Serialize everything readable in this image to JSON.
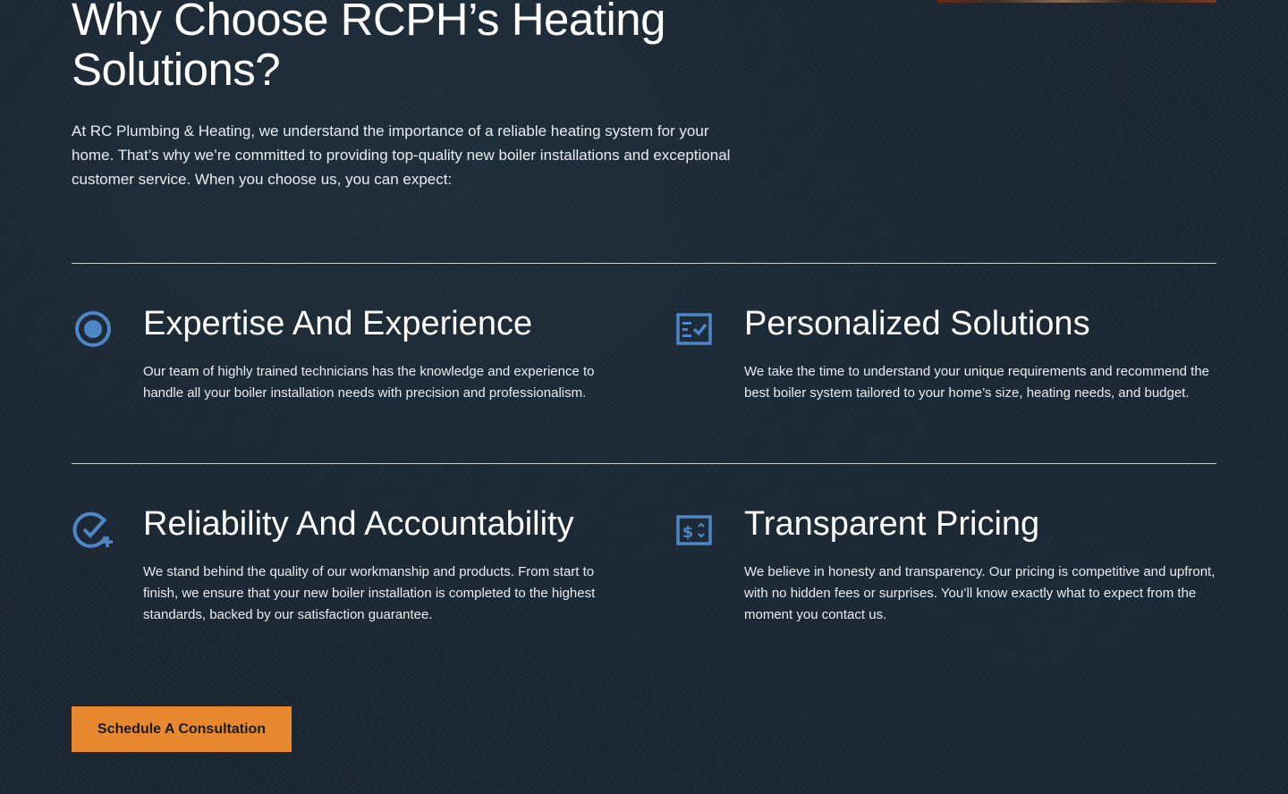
{
  "section": {
    "heading": "Why Choose RCPH’s Heating Solutions?",
    "intro": "At RC Plumbing & Heating, we understand the importance of a reliable heating system for your home. That’s why we’re committed to providing top-quality new boiler installations and exceptional customer service. When you choose us, you can expect:"
  },
  "features": [
    {
      "icon": "target-icon",
      "title": "Expertise And Experience",
      "description": "Our team of highly trained technicians has the knowledge and experience to handle all your boiler installation needs with precision and professionalism."
    },
    {
      "icon": "checklist-icon",
      "title": "Personalized Solutions",
      "description": "We take the time to understand your unique requirements and recommend the best boiler system tailored to your home’s size, heating needs, and budget."
    },
    {
      "icon": "check-plus-icon",
      "title": "Reliability And Accountability",
      "description": "We stand behind the quality of our workmanship and products. From start to finish, we ensure that your new boiler installation is completed to the highest standards, backed by our satisfaction guarantee."
    },
    {
      "icon": "pricing-icon",
      "title": "Transparent Pricing",
      "description": "We believe in honesty and transparency. Our pricing is competitive and upfront, with no hidden fees or surprises. You’ll know exactly what to expect from the moment you contact us."
    }
  ],
  "cta": {
    "label": "Schedule A Consultation"
  },
  "colors": {
    "background": "#1b2732",
    "accent_icon": "#4f86c6",
    "cta_background": "#e8892f",
    "text": "#ffffff"
  }
}
